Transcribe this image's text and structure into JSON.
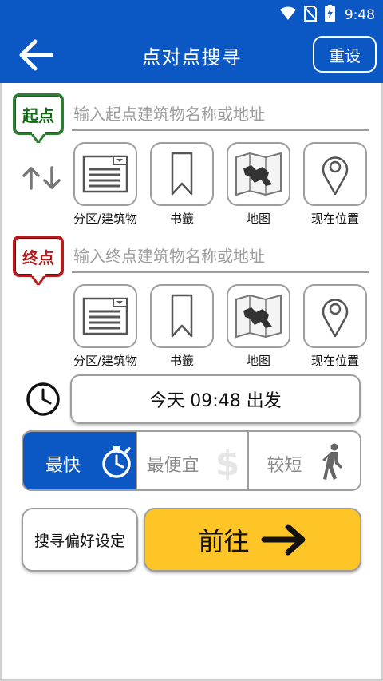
{
  "status_bar": {
    "time": "9:48",
    "icons": [
      "wifi-icon",
      "no-sim-icon",
      "battery-charging-icon"
    ]
  },
  "app_bar": {
    "title": "点对点搜寻",
    "back_icon": "arrow-left-icon",
    "reset_label": "重设"
  },
  "start": {
    "pin_label": "起点",
    "placeholder": "输入起点建筑物名称或地址",
    "options": [
      {
        "label": "分区/建筑物",
        "icon": "district-list-icon"
      },
      {
        "label": "书籤",
        "icon": "bookmark-icon"
      },
      {
        "label": "地图",
        "icon": "map-icon"
      },
      {
        "label": "现在位置",
        "icon": "location-pin-icon"
      }
    ]
  },
  "end": {
    "pin_label": "终点",
    "placeholder": "输入终点建筑物名称或地址",
    "options": [
      {
        "label": "分区/建筑物",
        "icon": "district-list-icon"
      },
      {
        "label": "书籤",
        "icon": "bookmark-icon"
      },
      {
        "label": "地图",
        "icon": "map-icon"
      },
      {
        "label": "现在位置",
        "icon": "location-pin-icon"
      }
    ]
  },
  "swap_icon": "swap-arrows-icon",
  "departure": {
    "icon": "clock-icon",
    "label": "今天 09:48 出发"
  },
  "route_modes": {
    "selected": "最快",
    "items": [
      {
        "label": "最快",
        "icon": "stopwatch-icon"
      },
      {
        "label": "最便宜",
        "icon": "dollar-icon"
      },
      {
        "label": "较短",
        "icon": "walking-person-icon"
      }
    ]
  },
  "actions": {
    "preferences_label": "搜寻偏好设定",
    "go_label": "前往",
    "go_icon": "arrow-right-icon"
  },
  "colors": {
    "primary": "#0b58c5",
    "start_green": "#2e7d32",
    "end_red": "#b71c1c",
    "go_yellow": "#ffc425",
    "border_gray": "#9e9e9e"
  }
}
